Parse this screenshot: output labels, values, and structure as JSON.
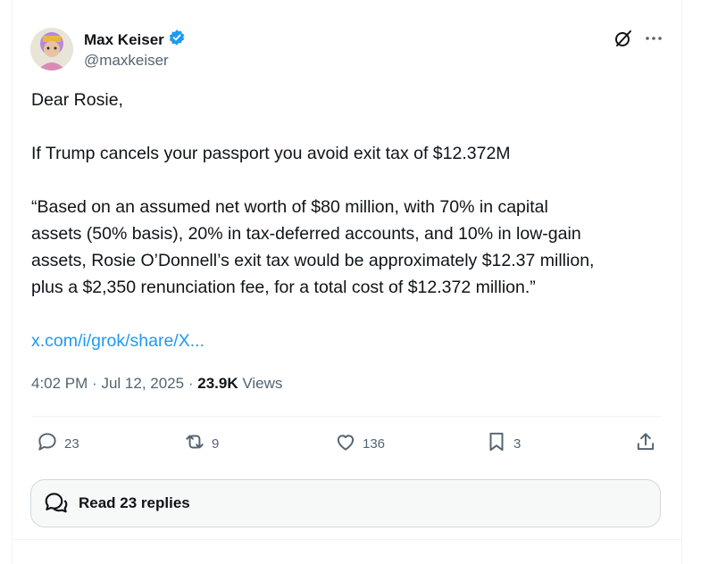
{
  "author": {
    "name": "Max Keiser",
    "handle": "@maxkeiser"
  },
  "tweet": {
    "greeting": "Dear Rosie,",
    "line1": "If Trump cancels your passport you avoid exit tax of $12.372M",
    "quote_lines": [
      "“Based on an assumed net worth of $80 million, with 70% in capital",
      "assets (50% basis), 20% in tax-deferred accounts, and 10% in low-gain",
      "assets, Rosie O’Donnell’s exit tax would be approximately $12.37 million,",
      "plus a $2,350 renunciation fee, for a total cost of $12.372 million.”"
    ],
    "link": "x.com/i/grok/share/X..."
  },
  "meta": {
    "time": "4:02 PM",
    "sep": "·",
    "date": "Jul 12, 2025",
    "views_count": "23.9K",
    "views_label": "Views"
  },
  "actions": {
    "replies": "23",
    "reposts": "9",
    "likes": "136",
    "bookmarks": "3"
  },
  "read_replies": "Read 23 replies",
  "icons": [
    "verified-badge-icon",
    "grok-icon",
    "more-icon",
    "reply-icon",
    "repost-icon",
    "like-icon",
    "bookmark-icon",
    "share-icon",
    "chat-bubble-icon"
  ],
  "colors": {
    "accent": "#1d9bf0",
    "text": "#0f1419",
    "secondary": "#536471"
  }
}
